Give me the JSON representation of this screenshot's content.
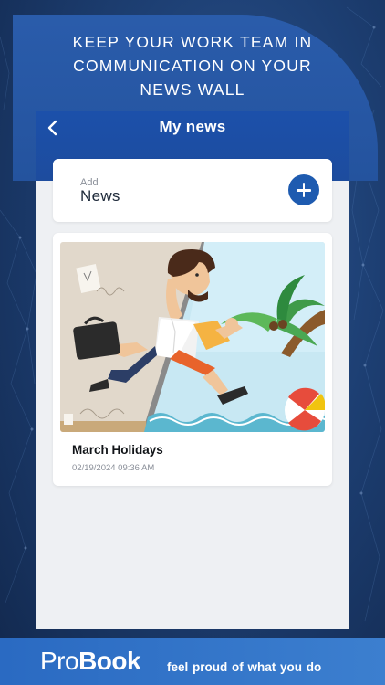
{
  "promo": {
    "headline": [
      "KEEP YOUR WORK TEAM IN",
      "COMMUNICATION ON YOUR",
      "NEWS WALL"
    ]
  },
  "app": {
    "title": "My news",
    "back_icon": "chevron-left-icon",
    "add_card": {
      "small_label": "Add",
      "big_label": "News",
      "button_icon": "plus-icon"
    },
    "news_items": [
      {
        "title": "March Holidays",
        "date": "02/19/2024 09:36 AM",
        "image": "office-to-beach-illustration"
      }
    ]
  },
  "footer": {
    "brand_light": "Pro",
    "brand_bold": "Book",
    "tagline": "feel proud of  what you do"
  },
  "colors": {
    "background": "#1d3f73",
    "accent_blue": "#1e5bb0",
    "appbar": "#1c50aa",
    "footer": "#3274c8",
    "card": "#ffffff",
    "screen": "#eef0f3"
  }
}
